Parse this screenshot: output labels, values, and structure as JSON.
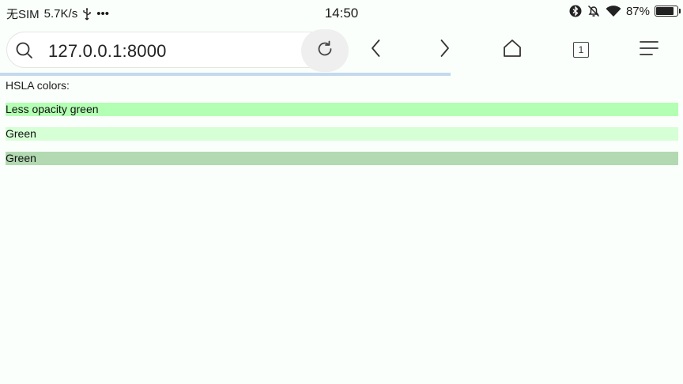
{
  "status_bar": {
    "carrier": "无SIM",
    "speed": "5.7K/s",
    "more": "•••",
    "time": "14:50",
    "battery_percent": "87%",
    "battery_level": 0.87
  },
  "toolbar": {
    "url": "127.0.0.1:8000",
    "tab_count": "1",
    "progress": 0.66,
    "progress_color": "#c3d9ee"
  },
  "page": {
    "heading": "HSLA colors:",
    "rows": [
      {
        "label": "Less opacity green",
        "color": "#b3ffb3"
      },
      {
        "label": "Green",
        "color": "#d6ffd6"
      },
      {
        "label": "Green",
        "color": "#b2d9b2"
      }
    ]
  },
  "icons": {
    "search": "search-icon",
    "reload": "reload-icon",
    "back": "chevron-left-icon",
    "forward": "chevron-right-icon",
    "home": "home-icon",
    "tabs": "tabs-icon",
    "menu": "menu-icon",
    "usb": "usb-icon",
    "bluetooth": "bluetooth-icon",
    "mute": "bell-off-icon",
    "wifi": "wifi-icon",
    "battery": "battery-icon"
  }
}
